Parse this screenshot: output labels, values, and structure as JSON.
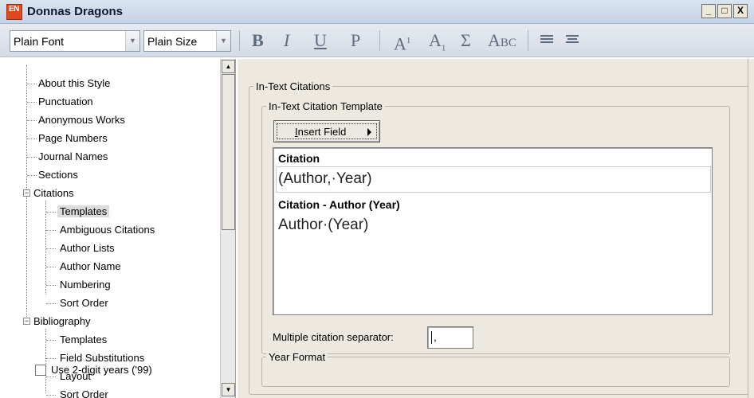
{
  "window": {
    "app_badge": "EN",
    "title": "Donnas Dragons",
    "minimize_glyph": "_",
    "maximize_glyph": "□",
    "close_glyph": "X"
  },
  "toolbar": {
    "font_combo": "Plain Font",
    "size_combo": "Plain Size",
    "combo_arrow": "▼",
    "bold": "B",
    "italic": "I",
    "underline": "U",
    "plain": "P",
    "superscript_base": "A",
    "superscript_mark": "1",
    "subscript_base": "A",
    "subscript_mark": "1",
    "symbol": "Σ",
    "smallcaps": "Abc"
  },
  "tree": {
    "items": [
      {
        "label": "About this Style"
      },
      {
        "label": "Punctuation"
      },
      {
        "label": "Anonymous Works"
      },
      {
        "label": "Page Numbers"
      },
      {
        "label": "Journal Names"
      },
      {
        "label": "Sections"
      },
      {
        "label": "Citations",
        "expander": "−"
      },
      {
        "label": "Templates"
      },
      {
        "label": "Ambiguous Citations"
      },
      {
        "label": "Author Lists"
      },
      {
        "label": "Author Name"
      },
      {
        "label": "Numbering"
      },
      {
        "label": "Sort Order"
      },
      {
        "label": "Bibliography",
        "expander": "−"
      },
      {
        "label": "Templates"
      },
      {
        "label": "Field Substitutions"
      },
      {
        "label": "Layout"
      },
      {
        "label": "Sort Order"
      }
    ],
    "selected_index": 7,
    "scroll_up": "▲",
    "scroll_down": "▼"
  },
  "panel": {
    "outer_group": "In-Text Citations",
    "template_group": "In-Text Citation Template",
    "insert_field_button": "Insert Field",
    "editor": {
      "heading_1": "Citation",
      "line_1": "(Author,·Year)",
      "heading_2": "Citation - Author (Year)",
      "line_2": "Author·(Year)"
    },
    "separator_label": "Multiple citation separator:",
    "separator_value": ",",
    "year_group": "Year Format",
    "year_checkbox_label": "Use 2-digit years ('99)",
    "year_checkbox_checked": false
  }
}
